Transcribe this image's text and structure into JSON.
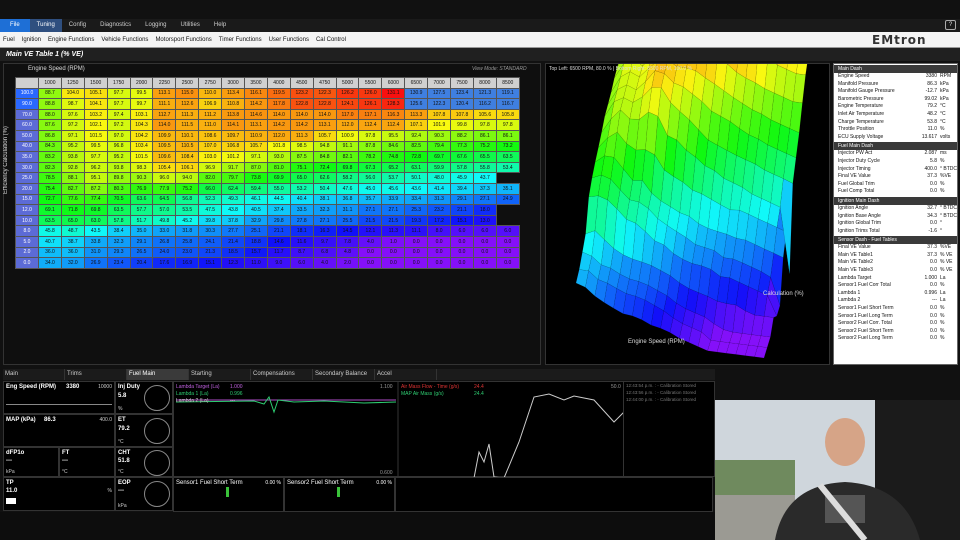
{
  "menu": {
    "items": [
      "File",
      "Tuning",
      "Config",
      "Diagnostics",
      "Logging",
      "Utilities",
      "Help"
    ],
    "active": "Tuning"
  },
  "ribbon": {
    "items": [
      "Fuel",
      "Ignition",
      "Engine Functions",
      "Vehicle Functions",
      "Motorsport Functions",
      "Timer Functions",
      "User Functions",
      "Cal Control"
    ]
  },
  "brand": {
    "logo": "EMtron"
  },
  "window": {
    "title": "Main VE Table 1 (% VE)"
  },
  "table": {
    "xaxis_label": "Engine Speed (RPM)",
    "yaxis_label": "Efficiency Calculation (%)",
    "view_mode": "View Mode: STANDARD",
    "rpm": [
      "1000",
      "1250",
      "1500",
      "1750",
      "2000",
      "2250",
      "2500",
      "2750",
      "3000",
      "3500",
      "4000",
      "4500",
      "4750",
      "5000",
      "5500",
      "6000",
      "6500",
      "7000",
      "7500",
      "8000",
      "8500"
    ],
    "rows": [
      {
        "label": "100.0",
        "cells": [
          "88.7",
          "104.0",
          "105.1",
          "97.7",
          "99.5",
          "113.1",
          "115.0",
          "110.0",
          "113.4",
          "116.1",
          "119.5",
          "123.2",
          "122.3",
          "126.2",
          "126.0",
          "131.1",
          "130.9",
          "127.5",
          "123.4",
          "121.3",
          "119.1"
        ]
      },
      {
        "label": "90.0",
        "cells": [
          "88.8",
          "98.7",
          "104.1",
          "97.7",
          "99.7",
          "111.1",
          "112.6",
          "106.9",
          "110.8",
          "114.2",
          "117.8",
          "122.8",
          "122.8",
          "124.1",
          "126.1",
          "128.3",
          "125.6",
          "122.3",
          "120.4",
          "116.2",
          "116.7"
        ]
      },
      {
        "label": "70.0",
        "cells": [
          "88.0",
          "97.6",
          "103.2",
          "97.4",
          "103.1",
          "112.7",
          "111.3",
          "111.2",
          "113.8",
          "114.6",
          "114.0",
          "114.0",
          "114.0",
          "117.0",
          "117.1",
          "116.3",
          "113.3",
          "107.8",
          "107.8",
          "105.6",
          "105.8"
        ]
      },
      {
        "label": "60.0",
        "cells": [
          "87.6",
          "97.2",
          "102.1",
          "97.2",
          "104.3",
          "114.0",
          "111.5",
          "111.0",
          "114.1",
          "113.1",
          "114.2",
          "114.2",
          "113.1",
          "112.0",
          "112.4",
          "112.4",
          "107.1",
          "101.9",
          "99.8",
          "97.8",
          "97.8"
        ]
      },
      {
        "label": "50.0",
        "cells": [
          "86.8",
          "97.1",
          "101.5",
          "97.0",
          "104.2",
          "109.9",
          "110.1",
          "108.6",
          "109.7",
          "110.9",
          "112.0",
          "111.3",
          "105.7",
          "100.9",
          "97.8",
          "95.5",
          "92.4",
          "90.3",
          "88.2",
          "86.1",
          "86.1"
        ]
      },
      {
        "label": "40.0",
        "cells": [
          "84.3",
          "95.2",
          "99.5",
          "96.8",
          "103.4",
          "109.5",
          "110.5",
          "107.0",
          "106.8",
          "105.7",
          "101.8",
          "98.5",
          "94.8",
          "91.1",
          "87.8",
          "84.6",
          "82.5",
          "79.4",
          "77.3",
          "75.2",
          "73.2"
        ]
      },
      {
        "label": "35.0",
        "cells": [
          "83.2",
          "93.8",
          "97.7",
          "95.2",
          "101.5",
          "109.6",
          "108.4",
          "103.0",
          "101.2",
          "97.1",
          "93.0",
          "87.5",
          "84.8",
          "82.1",
          "78.2",
          "74.8",
          "72.8",
          "69.7",
          "67.6",
          "65.5",
          "63.5"
        ]
      },
      {
        "label": "30.0",
        "cells": [
          "82.3",
          "92.8",
          "96.2",
          "93.8",
          "98.3",
          "105.4",
          "106.1",
          "96.9",
          "91.7",
          "87.0",
          "81.0",
          "75.1",
          "72.4",
          "69.8",
          "67.3",
          "65.2",
          "63.1",
          "59.9",
          "57.8",
          "55.8",
          "53.4"
        ]
      },
      {
        "label": "25.0",
        "cells": [
          "78.5",
          "88.1",
          "95.1",
          "89.8",
          "90.3",
          "96.0",
          "94.0",
          "82.0",
          "79.7",
          "73.8",
          "69.9",
          "65.0",
          "62.6",
          "58.2",
          "56.0",
          "53.7",
          "50.1",
          "48.0",
          "45.9",
          "43.7"
        ]
      },
      {
        "label": "20.0",
        "cells": [
          "75.4",
          "82.7",
          "87.2",
          "80.3",
          "76.9",
          "77.9",
          "75.2",
          "66.0",
          "62.4",
          "59.4",
          "55.0",
          "53.2",
          "50.4",
          "47.6",
          "45.0",
          "45.6",
          "43.6",
          "41.4",
          "39.4",
          "37.3",
          "35.1"
        ]
      },
      {
        "label": "15.0",
        "cells": [
          "72.7",
          "77.6",
          "77.4",
          "70.5",
          "63.6",
          "64.5",
          "56.8",
          "52.3",
          "49.3",
          "46.1",
          "44.5",
          "40.4",
          "38.1",
          "36.8",
          "35.7",
          "33.9",
          "33.4",
          "31.3",
          "29.1",
          "27.1",
          "24.9"
        ]
      },
      {
        "label": "12.0",
        "cells": [
          "69.1",
          "71.8",
          "69.8",
          "63.5",
          "57.7",
          "57.0",
          "53.5",
          "47.5",
          "43.8",
          "40.5",
          "37.4",
          "33.5",
          "32.3",
          "31.1",
          "27.1",
          "27.1",
          "25.3",
          "23.2",
          "21.1",
          "18.0"
        ]
      },
      {
        "label": "10.0",
        "cells": [
          "63.5",
          "65.0",
          "63.0",
          "57.8",
          "51.7",
          "49.8",
          "45.2",
          "39.8",
          "37.8",
          "32.9",
          "29.8",
          "27.8",
          "27.1",
          "25.5",
          "21.5",
          "21.5",
          "19.3",
          "17.2",
          "15.1",
          "13.0"
        ]
      },
      {
        "label": "8.0",
        "cells": [
          "45.8",
          "48.7",
          "43.5",
          "38.4",
          "35.0",
          "33.0",
          "31.8",
          "30.3",
          "27.7",
          "25.1",
          "21.1",
          "18.1",
          "16.3",
          "14.5",
          "12.1",
          "11.3",
          "11.1",
          "8.0",
          "6.0",
          "6.0",
          "6.0"
        ]
      },
      {
        "label": "5.0",
        "cells": [
          "40.7",
          "38.7",
          "33.8",
          "32.3",
          "29.1",
          "26.8",
          "25.8",
          "24.1",
          "21.4",
          "18.8",
          "14.6",
          "11.6",
          "9.7",
          "7.8",
          "4.0",
          "1.0",
          "0.0",
          "0.0",
          "0.0",
          "0.0",
          "0.0"
        ]
      },
      {
        "label": "2.0",
        "cells": [
          "36.0",
          "36.0",
          "31.0",
          "29.3",
          "26.5",
          "24.0",
          "23.0",
          "21.3",
          "18.5",
          "15.7",
          "11.7",
          "8.7",
          "6.8",
          "4.8",
          "0.0",
          "0.0",
          "0.0",
          "0.0",
          "0.0",
          "0.0",
          "0.0"
        ]
      },
      {
        "label": "0.0",
        "cells": [
          "34.0",
          "32.0",
          "26.9",
          "23.4",
          "20.4",
          "17.6",
          "16.9",
          "15.1",
          "12.3",
          "11.0",
          "9.0",
          "6.0",
          "4.0",
          "2.0",
          "0.0",
          "0.0",
          "0.0",
          "0.0",
          "0.0",
          "0.0",
          "0.0"
        ]
      }
    ]
  },
  "graph": {
    "info": "Top Left: 6500 RPM, 80.0 % | Bottom Right: 8500 RPM, 100.0 %",
    "axis1": "Calculation (%)",
    "axis2": "Engine Speed (RPM)"
  },
  "side": {
    "groups": [
      {
        "title": "Main Dash",
        "rows": [
          [
            "Engine Speed",
            "3380",
            "RPM"
          ],
          [
            "Manifold Pressure",
            "86.3",
            "kPa"
          ],
          [
            "Manifold Gauge Pressure",
            "-12.7",
            "kPa"
          ],
          [
            "Barometric Pressure",
            "99.02",
            "kPa"
          ],
          [
            "Engine Temperature",
            "79.2",
            "°C"
          ],
          [
            "Inlet Air Temperature",
            "48.2",
            "°C"
          ],
          [
            "Charge Temperature",
            "53.8",
            "°C"
          ],
          [
            "Throttle Position",
            "11.0",
            "%"
          ],
          [
            "ECU Supply Voltage",
            "13.617",
            "volts"
          ]
        ]
      },
      {
        "title": "Fuel Main Dash",
        "rows": [
          [
            "Injector PW Act",
            "2.087",
            "ms"
          ],
          [
            "Injector Duty Cycle",
            "5.8",
            "%"
          ],
          [
            "Injector Timing",
            "400.0",
            "° BTDC"
          ],
          [
            "Final VE Value",
            "37.3",
            "%VE"
          ],
          [
            "Fuel Global Trim",
            "0.0",
            "%"
          ],
          [
            "Fuel Comp Total",
            "0.0",
            "%"
          ]
        ]
      },
      {
        "title": "Ignition Main Dash",
        "rows": [
          [
            "Ignition Angle",
            "32.7",
            "° BTDC"
          ],
          [
            "Ignition Base Angle",
            "34.3",
            "° BTDC"
          ],
          [
            "Ignition Global Trim",
            "0.0",
            "°"
          ],
          [
            "Ignition Trims Total",
            "-1.6",
            "°"
          ]
        ]
      },
      {
        "title": "Sensor Dash - Fuel Tables",
        "rows": [
          [
            "Final VE Value",
            "37.3",
            "%VE"
          ],
          [
            "Main VE Table1",
            "37.3",
            "% VE"
          ],
          [
            "Main VE Table2",
            "0.0",
            "% VE"
          ],
          [
            "Main VE Table3",
            "0.0",
            "% VE"
          ],
          [
            "Lambda Target",
            "1.000",
            "La"
          ],
          [
            "Sensor1 Fuel Corr Total",
            "0.0",
            "%"
          ],
          [
            "Lambda 1",
            "0.996",
            "La"
          ],
          [
            "Lambda 2",
            "---",
            "La"
          ],
          [
            "Sensor1 Fuel Short Term",
            "0.0",
            "%"
          ],
          [
            "Sensor1 Fuel Long Term",
            "0.0",
            "%"
          ],
          [
            "Sensor2 Fuel Corr. Total",
            "0.0",
            "%"
          ],
          [
            "Sensor2 Fuel Short Term",
            "0.0",
            "%"
          ],
          [
            "Sensor2 Fuel Long Term",
            "0.0",
            "%"
          ]
        ]
      }
    ]
  },
  "bottom_tabs": [
    "Main",
    "Trims",
    "Fuel Main",
    "Starting",
    "Compensations",
    "Secondary Balance",
    "Accel"
  ],
  "bottom_active": "Fuel Main",
  "gauges": {
    "eng": {
      "label": "Eng Speed (RPM)",
      "value": "3380",
      "max": "10000"
    },
    "inj": {
      "label": "Inj Duty",
      "value": "5.8",
      "unit": "%"
    },
    "map": {
      "label": "MAP (kPa)",
      "value": "86.3",
      "max": "400.0"
    },
    "et": {
      "label": "ET",
      "value": "79.2",
      "unit": "°C"
    },
    "dfp": {
      "label": "dFP1o",
      "value": "---",
      "unit": "kPa"
    },
    "ft": {
      "label": "FT",
      "value": "---",
      "unit": "°C"
    },
    "cht": {
      "label": "CHT",
      "value": "51.8",
      "unit": "°C"
    },
    "tp": {
      "label": "TP",
      "value": "11.0",
      "unit": "%"
    },
    "eop": {
      "label": "EOP",
      "value": "---",
      "unit": "kPa"
    }
  },
  "log": {
    "l1": "Lambda Target (La)",
    "v1": "1.000",
    "l2": "Lambda 1 (La)",
    "v2": "0.996",
    "l3": "Lambda 2 (La)",
    "v3": "---",
    "rmax": "1.100",
    "rmin": "0.600",
    "l4": "Air Mass Flow - Time (g/s)",
    "v4": "24.4",
    "l5": "MAP Air Mass (g/s)",
    "v5": "24.4",
    "rmax2": "50.0"
  },
  "messages": [
    "12:43:54 p.m. : - Calibration Stored",
    "12:43:56 p.m. : - Calibration Stored",
    "12:44:00 p.m. : - Calibration Stored"
  ],
  "lower": {
    "s1": "Sensor1 Fuel Short Term",
    "s1v": "0.00 %",
    "s2": "Sensor2 Fuel Short Term",
    "s2v": "0.00 %"
  }
}
